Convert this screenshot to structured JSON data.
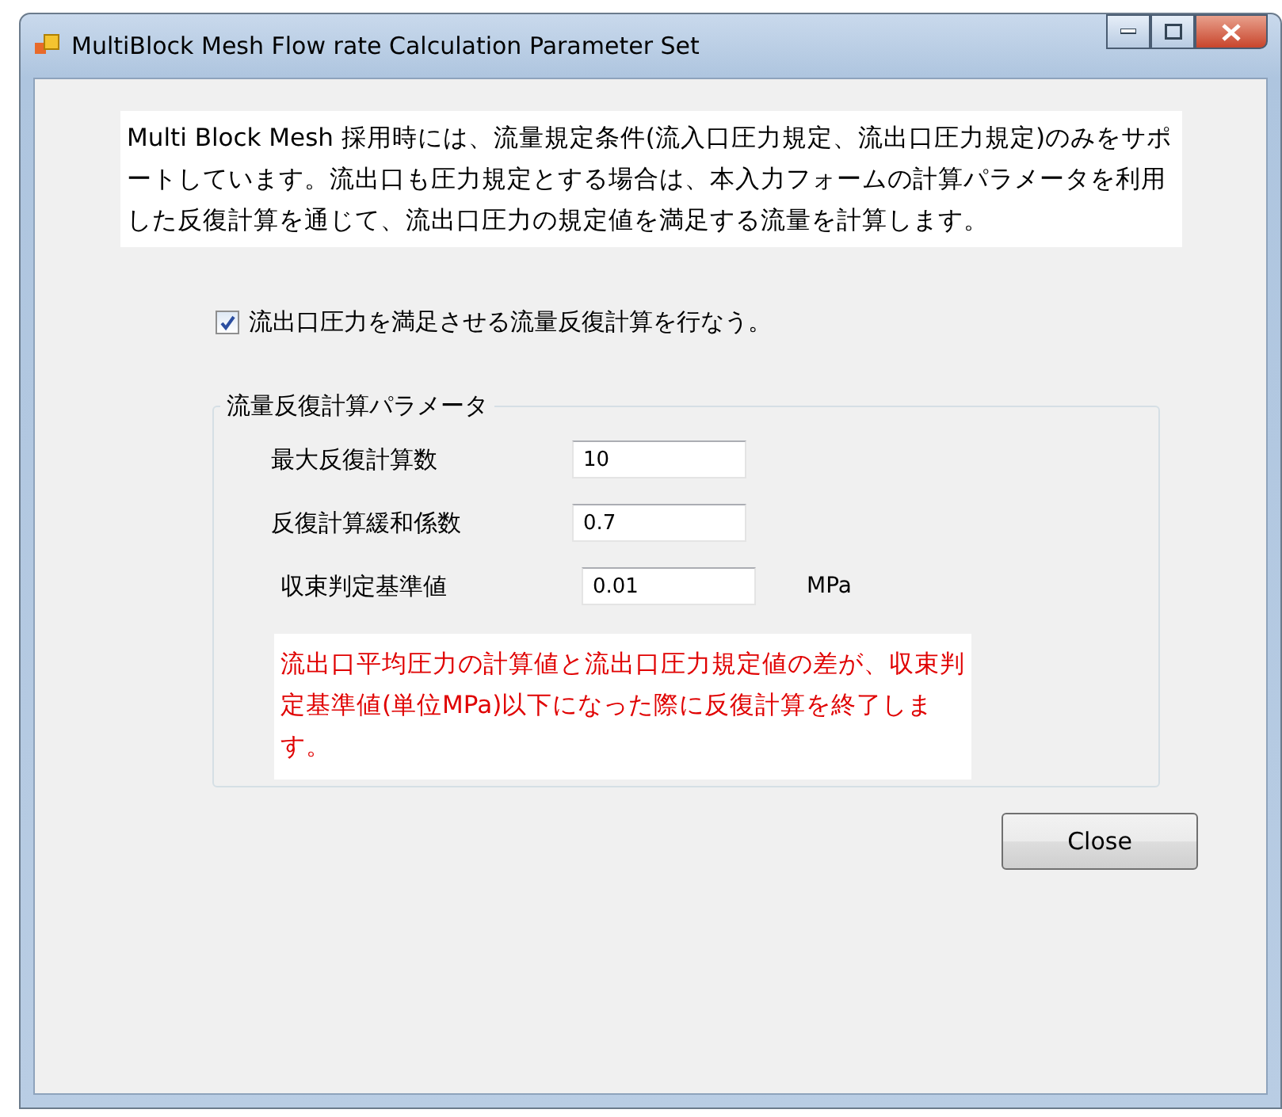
{
  "window": {
    "title": "MultiBlock Mesh Flow rate Calculation Parameter Set"
  },
  "description": "Multi Block Mesh 採用時には、流量規定条件(流入口圧力規定、流出口圧力規定)のみをサポートしています。流出口も圧力規定とする場合は、本入力フォームの計算パラメータを利用した反復計算を通じて、流出口圧力の規定値を満足する流量を計算します。",
  "iterate_checkbox": {
    "label": "流出口圧力を満足させる流量反復計算を行なう。",
    "checked": true
  },
  "group": {
    "title": "流量反復計算パラメータ",
    "fields": [
      {
        "label": "最大反復計算数",
        "value": "10"
      },
      {
        "label": "反復計算緩和係数",
        "value": "0.7"
      },
      {
        "label": "収束判定基準値",
        "value": "0.01",
        "unit": "MPa"
      }
    ],
    "note": "流出口平均圧力の計算値と流出口圧力規定値の差が、収束判定基準値(単位MPa)以下になった際に反復計算を終了します。"
  },
  "buttons": [
    {
      "label": "Close"
    }
  ]
}
